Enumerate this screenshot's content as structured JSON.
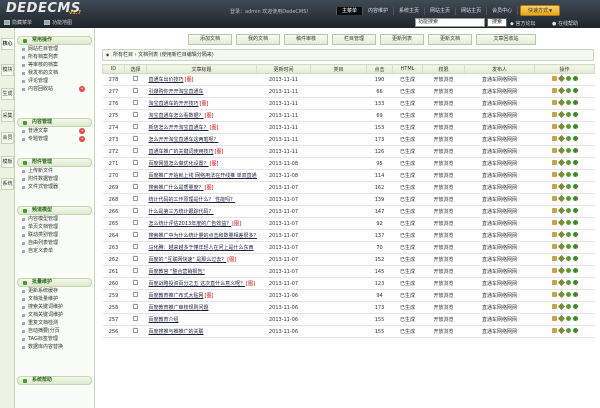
{
  "app": {
    "logo_text": "DEDECMS",
    "logo_version": "v5.7",
    "user_info": "登录：admin  欢迎使用DedeCMS!",
    "main_menu": [
      "主菜单",
      "内容维护",
      "系统主页",
      "网站主页",
      "网站主页",
      "会员中心",
      "注销"
    ],
    "quick_menu": "快速方式",
    "quit": "",
    "toolbar_tabs": [
      "隐藏菜单",
      "功能地图"
    ],
    "search_placeholder": "功能搜索",
    "search_button": "搜索",
    "official_link": "官方论坛",
    "order_link": "在线帮助"
  },
  "sidebar": {
    "tabs": [
      {
        "label": "核心",
        "active": true
      },
      {
        "label": "模块",
        "active": false
      },
      {
        "label": "生成",
        "active": false
      },
      {
        "label": "采集",
        "active": false
      },
      {
        "label": "会员",
        "active": false
      },
      {
        "label": "模板",
        "active": false
      },
      {
        "label": "系统",
        "active": false
      }
    ],
    "groups": [
      {
        "title": "常用操作",
        "items": [
          {
            "label": "网站栏目管理",
            "add": false
          },
          {
            "label": "所有档案列表",
            "add": false
          },
          {
            "label": "等审核的档案",
            "add": false
          },
          {
            "label": "我发布的文档",
            "add": false
          },
          {
            "label": "评论管理",
            "add": false
          },
          {
            "label": "内容回收站",
            "add": true
          }
        ]
      },
      {
        "title": "内容管理",
        "items": [
          {
            "label": "普通文章",
            "add": true
          },
          {
            "label": "专题管理",
            "add": true
          }
        ]
      },
      {
        "title": "附件管理",
        "items": [
          {
            "label": "上传新文件",
            "add": false
          },
          {
            "label": "附件数据管理",
            "add": false
          },
          {
            "label": "文件式管理器",
            "add": false
          }
        ]
      },
      {
        "title": "频道模型",
        "items": [
          {
            "label": "内容模型管理",
            "add": false
          },
          {
            "label": "单页文档管理",
            "add": false
          },
          {
            "label": "联动类别管理",
            "add": false
          },
          {
            "label": "自由列表管理",
            "add": false
          },
          {
            "label": "自定义表单",
            "add": false
          }
        ]
      },
      {
        "title": "批量维护",
        "items": [
          {
            "label": "更新系统缓存",
            "add": false
          },
          {
            "label": "文档批量维护",
            "add": false
          },
          {
            "label": "搜索关键词维护",
            "add": false
          },
          {
            "label": "文档关键词维护",
            "add": false
          },
          {
            "label": "重复文档检测",
            "add": false
          },
          {
            "label": "自动摘要|分页",
            "add": false
          },
          {
            "label": "TAG标签管理",
            "add": false
          },
          {
            "label": "数据库内容替换",
            "add": false
          }
        ]
      },
      {
        "title": "系统帮助",
        "items": []
      }
    ]
  },
  "toolbar": {
    "buttons": [
      "添加文档",
      "我的文档",
      "稿件审核",
      "栏目管理",
      "更新列表",
      "更新文档",
      "文章回收站"
    ]
  },
  "breadcrumb": "所有栏目 › 文档列表    (使用新栏目编辑分隔来)",
  "table": {
    "headers": [
      "ID",
      "选择",
      "文章标题",
      "更新时间",
      "类目",
      "点击",
      "HTML",
      "权限",
      "发布人",
      "操作"
    ],
    "rows": [
      {
        "id": "278",
        "title": "直通车出价技巧",
        "flag": "[图]",
        "date": "2013-11-11",
        "cat": "",
        "clicks": "190",
        "html": "已生成",
        "perm": "开放浏览",
        "author": "直通车网络网网"
      },
      {
        "id": "277",
        "title": "引爆购你开开淘宝直通车",
        "flag": "",
        "date": "2013-11-11",
        "cat": "",
        "clicks": "66",
        "html": "已生成",
        "perm": "开放浏览",
        "author": "直通车网络网网"
      },
      {
        "id": "276",
        "title": "淘宝直通车的开开技巧",
        "flag": "[图]",
        "date": "2013-11-11",
        "cat": "",
        "clicks": "133",
        "html": "已生成",
        "perm": "开放浏览",
        "author": "直通车网络网网"
      },
      {
        "id": "275",
        "title": "淘宝直通车怎么看数据？",
        "flag": "[图]",
        "date": "2013-11-11",
        "cat": "",
        "clicks": "69",
        "html": "已生成",
        "perm": "开放浏览",
        "author": "直通车网络网网"
      },
      {
        "id": "274",
        "title": "新店怎么开开淘宝直通车？",
        "flag": "[图]",
        "date": "2013-11-11",
        "cat": "",
        "clicks": "153",
        "html": "已生成",
        "perm": "开放浏览",
        "author": "直通车网络网网"
      },
      {
        "id": "273",
        "title": "怎么开开淘宝直通车这两笔呢？",
        "flag": "",
        "date": "2013-11-11",
        "cat": "",
        "clicks": "173",
        "html": "已生成",
        "perm": "开放浏览",
        "author": "直通车网络网网"
      },
      {
        "id": "272",
        "title": "直通车推广的关键词使用技巧",
        "flag": "[图]",
        "date": "2013-11-11",
        "cat": "",
        "clicks": "126",
        "html": "已生成",
        "perm": "开放浏览",
        "author": "直通车网络网网"
      },
      {
        "id": "271",
        "title": "百度网盟怎么做优化设置？",
        "flag": "[图]",
        "date": "2013-11-08",
        "cat": "",
        "clicks": "95",
        "html": "已生成",
        "perm": "开放浏览",
        "author": "直通车网络网网"
      },
      {
        "id": "270",
        "title": "百度推广开始就上线 网络用法在开线推 单双直通了",
        "flag": "",
        "date": "2013-11-08",
        "cat": "",
        "clicks": "114",
        "html": "已生成",
        "perm": "开放浏览",
        "author": "直通车网络网网"
      },
      {
        "id": "269",
        "title": "搜索推广什么是质量度？",
        "flag": "[图]",
        "date": "2013-11-07",
        "cat": "",
        "clicks": "162",
        "html": "已生成",
        "perm": "开放浏览",
        "author": "直通车网络网网"
      },
      {
        "id": "268",
        "title": "统计代码的工作原理是什么？ 性能吗？",
        "flag": "",
        "date": "2013-11-07",
        "cat": "",
        "clicks": "139",
        "html": "已生成",
        "perm": "开放浏览",
        "author": "直通车网络网网"
      },
      {
        "id": "266",
        "title": "什么是第三方统计跟踪代码？",
        "flag": "",
        "date": "2013-11-07",
        "cat": "",
        "clicks": "147",
        "html": "已生成",
        "perm": "开放浏览",
        "author": "直通车网络网网"
      },
      {
        "id": "265",
        "title": "怎么统计评估2013年度的广告效益？",
        "flag": "[图]",
        "date": "2013-11-07",
        "cat": "",
        "clicks": "92",
        "html": "已生成",
        "perm": "开放浏览",
        "author": "直通车网络网网"
      },
      {
        "id": "264",
        "title": "搜索推广中为什么统计量的点击和数量相差很多？",
        "flag": "",
        "date": "2013-11-07",
        "cat": "",
        "clicks": "137",
        "html": "已生成",
        "perm": "开放浏览",
        "author": "直通车网络网网"
      },
      {
        "id": "263",
        "title": "马化腾：越来越多于懂年轻人在问上是什么东西",
        "flag": "",
        "date": "2013-11-07",
        "cat": "",
        "clicks": "70",
        "html": "已生成",
        "perm": "开放浏览",
        "author": "直通车网络网网"
      },
      {
        "id": "262",
        "title": "百度的 \"互联网快速\" 是那么过去？",
        "flag": "[图]",
        "date": "2013-11-07",
        "cat": "",
        "clicks": "152",
        "html": "已生成",
        "perm": "开放浏览",
        "author": "直通车网络网网"
      },
      {
        "id": "261",
        "title": "百度教官 \"整合营销报告\"",
        "flag": "",
        "date": "2013-11-07",
        "cat": "",
        "clicks": "145",
        "html": "已生成",
        "perm": "开放浏览",
        "author": "直通车网络网网"
      },
      {
        "id": "260",
        "title": "百度战略投资百分之五 这次直什么意义呢？",
        "flag": "[图]",
        "date": "2013-11-07",
        "cat": "",
        "clicks": "123",
        "html": "已生成",
        "perm": "开放浏览",
        "author": "直通车网络网网"
      },
      {
        "id": "259",
        "title": "百度教育推广布式大贴网",
        "flag": "[图]",
        "date": "2013-11-06",
        "cat": "",
        "clicks": "94",
        "html": "已生成",
        "perm": "开放浏览",
        "author": "直通车网络网网"
      },
      {
        "id": "258",
        "title": "百度教育推广审核规则问题",
        "flag": "",
        "date": "2013-11-06",
        "cat": "",
        "clicks": "173",
        "html": "已生成",
        "perm": "开放浏览",
        "author": "直通车网络网网"
      },
      {
        "id": "257",
        "title": "百度教育介绍",
        "flag": "",
        "date": "2013-11-06",
        "cat": "",
        "clicks": "155",
        "html": "已生成",
        "perm": "开放浏览",
        "author": "直通车网络网网"
      },
      {
        "id": "256",
        "title": "百度搜推与推推广的关联",
        "flag": "",
        "date": "2013-11-06",
        "cat": "",
        "clicks": "155",
        "html": "已生成",
        "perm": "开放浏览",
        "author": "直通车网络网网"
      }
    ]
  }
}
